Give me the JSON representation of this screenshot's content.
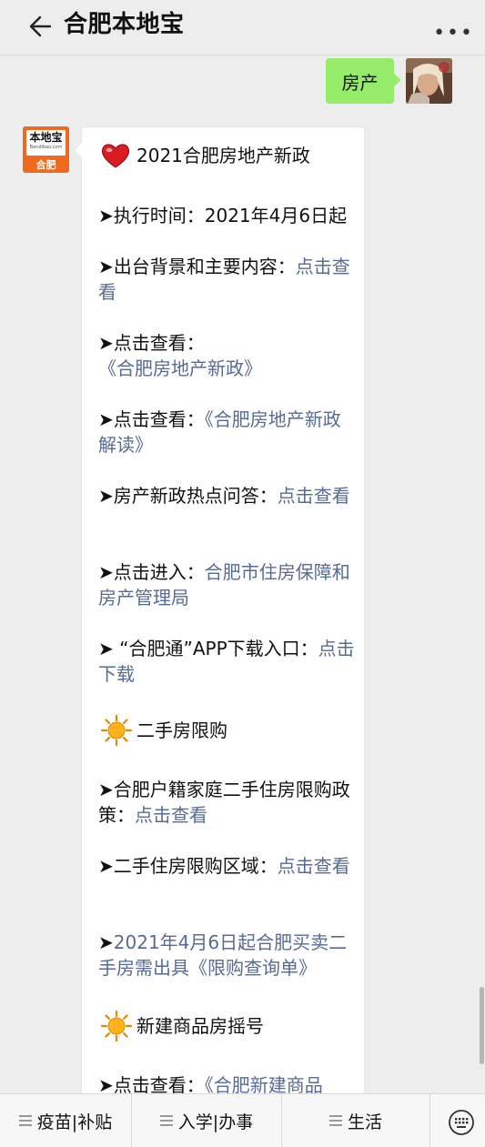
{
  "header": {
    "title": "合肥本地宝"
  },
  "user_message": {
    "text": "房产"
  },
  "bot": {
    "avatar_brand": "本地宝",
    "avatar_sub": "Bendibao.com",
    "avatar_city": "合肥"
  },
  "message": {
    "heading1": "2021合肥房地产新政",
    "items1": [
      {
        "prefix": "➤执行时间：2021年4月6日起",
        "link": ""
      },
      {
        "prefix": "➤出台背景和主要内容：",
        "link": "点击查看"
      },
      {
        "prefix": "➤点击查看：",
        "link": "《合肥房地产新政》"
      },
      {
        "prefix": "➤点击查看：",
        "link": "《合肥房地产新政解读》"
      },
      {
        "prefix": "➤房产新政热点问答：",
        "link": "点击查看"
      },
      {
        "prefix": "➤点击进入：",
        "link": "合肥市住房保障和房产管理局"
      },
      {
        "prefix": "➤ “合肥通”APP下载入口：",
        "link": "点击下载"
      }
    ],
    "heading2": "二手房限购",
    "items2": [
      {
        "prefix": "➤合肥户籍家庭二手住房限购政策：",
        "link": "点击查看"
      },
      {
        "prefix": "➤二手住房限购区域：",
        "link": "点击查看"
      },
      {
        "prefix": "➤",
        "link": "2021年4月6日起合肥买卖二手房需出具《限购查询单》"
      }
    ],
    "heading3": "新建商品房摇号",
    "items3": [
      {
        "prefix": "➤点击查看：",
        "link": "《合肥新建商品"
      }
    ]
  },
  "bottom_menu": {
    "tab1": "疫苗|补贴",
    "tab2": "入学|办事",
    "tab3": "生活"
  },
  "colors": {
    "link": "#576b95",
    "user_bubble": "#95ec69",
    "avatar_orange": "#ef6a1c"
  }
}
